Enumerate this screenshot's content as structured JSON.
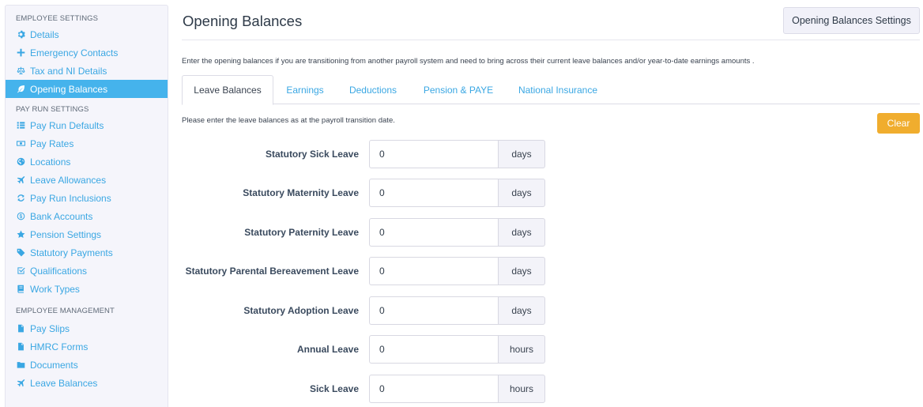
{
  "sidebar": {
    "sections": [
      {
        "title": "EMPLOYEE SETTINGS",
        "items": [
          {
            "label": "Details",
            "icon": "gear-icon"
          },
          {
            "label": "Emergency Contacts",
            "icon": "plus-icon"
          },
          {
            "label": "Tax and NI Details",
            "icon": "balance-scale-icon"
          },
          {
            "label": "Opening Balances",
            "icon": "leaf-icon",
            "active": true
          }
        ]
      },
      {
        "title": "PAY RUN SETTINGS",
        "items": [
          {
            "label": "Pay Run Defaults",
            "icon": "list-icon"
          },
          {
            "label": "Pay Rates",
            "icon": "money-icon"
          },
          {
            "label": "Locations",
            "icon": "globe-icon"
          },
          {
            "label": "Leave Allowances",
            "icon": "plane-icon"
          },
          {
            "label": "Pay Run Inclusions",
            "icon": "refresh-icon"
          },
          {
            "label": "Bank Accounts",
            "icon": "dollar-circle-icon"
          },
          {
            "label": "Pension Settings",
            "icon": "star-icon"
          },
          {
            "label": "Statutory Payments",
            "icon": "tag-icon"
          },
          {
            "label": "Qualifications",
            "icon": "check-square-icon"
          },
          {
            "label": "Work Types",
            "icon": "book-icon"
          }
        ]
      },
      {
        "title": "EMPLOYEE MANAGEMENT",
        "items": [
          {
            "label": "Pay Slips",
            "icon": "file-icon"
          },
          {
            "label": "HMRC Forms",
            "icon": "file-icon"
          },
          {
            "label": "Documents",
            "icon": "folder-icon"
          },
          {
            "label": "Leave Balances",
            "icon": "plane-icon"
          }
        ]
      }
    ]
  },
  "header": {
    "title": "Opening Balances",
    "settings_button": "Opening Balances Settings"
  },
  "intro": "Enter the opening balances if you are transitioning from another payroll system and need to bring across their current leave balances and/or year-to-date earnings amounts .",
  "tabs": [
    "Leave Balances",
    "Earnings",
    "Deductions",
    "Pension & PAYE",
    "National Insurance"
  ],
  "active_tab": "Leave Balances",
  "subnote": "Please enter the leave balances as at the payroll transition date.",
  "clear_button": "Clear",
  "leave_rows": [
    {
      "label": "Statutory Sick Leave",
      "value": "0",
      "unit": "days"
    },
    {
      "label": "Statutory Maternity Leave",
      "value": "0",
      "unit": "days"
    },
    {
      "label": "Statutory Paternity Leave",
      "value": "0",
      "unit": "days"
    },
    {
      "label": "Statutory Parental Bereavement Leave",
      "value": "0",
      "unit": "days"
    },
    {
      "label": "Statutory Adoption Leave",
      "value": "0",
      "unit": "days"
    },
    {
      "label": "Annual Leave",
      "value": "0",
      "unit": "hours"
    },
    {
      "label": "Sick Leave",
      "value": "0",
      "unit": "hours"
    }
  ],
  "colors": {
    "accent": "#3aa7e3",
    "active_item_bg": "#45b3ec",
    "clear_button": "#f0ad2e"
  }
}
